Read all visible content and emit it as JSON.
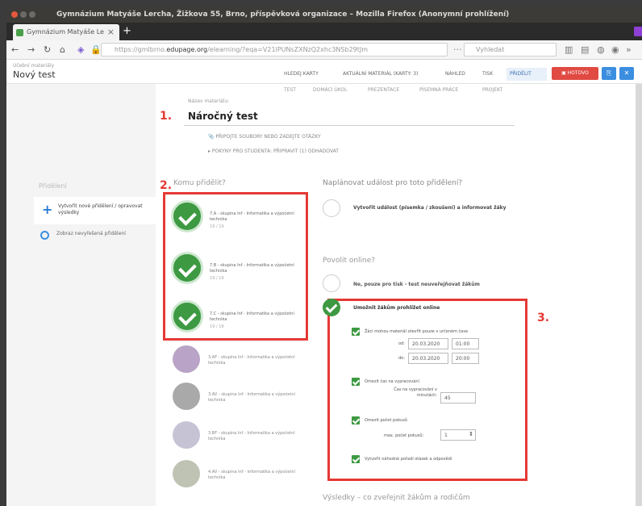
{
  "window": {
    "title": "Gymnázium Matyáše Lercha, Žižkova 55, Brno, příspěvková organizace – Mozilla Firefox (Anonymní prohlížení)"
  },
  "browser": {
    "tab_label": "Gymnázium Matyáše Le",
    "url_prefix": "https://gmlbrno.",
    "url_domain": "edupage.org",
    "url_rest": "/elearning/?eqa=V21lPUNsZXNzQ2xhc3NSb29tJm",
    "search_placeholder": "Vyhledat"
  },
  "app": {
    "breadcrumb": "Učební materiály",
    "doc_title": "Nový test",
    "menu": [
      "HLEDEJ KARTY",
      "AKTUÁLNÍ MATERIÁL (KARTY: 3)",
      "NÁHLED",
      "TISK",
      "PŘIDĚLIT"
    ],
    "done_label": "HOTOVO",
    "sub_tabs": [
      "TEST",
      "DOMÁCÍ ÚKOL",
      "PREZENTACE",
      "PÍSEMNÁ PRÁCE",
      "PROJEKT"
    ]
  },
  "left": {
    "title": "Přidělení",
    "item1": "Vytvořit nové přidělení / opravovat výsledky",
    "item2": "Zobraz nevyřešená přidělení"
  },
  "material": {
    "label": "Název materiálu:",
    "value": "Náročný test",
    "option1": "PŘIPOJTE SOUBORY NEBO ZADEJTE OTÁZKY",
    "option2": "POKYNY PRO STUDENTA: PŘIPRAVIT (1) ODHADOVAT"
  },
  "numbers": {
    "n1": "1.",
    "n2": "2.",
    "n3": "3."
  },
  "assign": {
    "title": "Komu přidělit?",
    "selected": [
      {
        "name": "7.A - skupina Inf - Informatika a výpočetní technika",
        "count": "19 / 19"
      },
      {
        "name": "7.B - skupina Inf - Informatika a výpočetní technika",
        "count": "19 / 19"
      },
      {
        "name": "7.C - skupina Inf - Informatika a výpočetní technika",
        "count": "19 / 19"
      }
    ],
    "unselected": [
      {
        "name": "3.AF - skupina Inf - Informatika a výpočetní technika"
      },
      {
        "name": "3.AV - skupina Inf - Informatika a výpočetní technika"
      },
      {
        "name": "3.BF - skupina Inf - Informatika a výpočetní technika"
      },
      {
        "name": "4.AV - skupina Inf - Informatika a výpočetní technika"
      }
    ]
  },
  "event": {
    "title": "Naplánovat událost pro toto přidělení?",
    "label": "Vytvořit událost (písemka / zkoušení) a informovat žáky"
  },
  "online": {
    "title": "Povolit online?",
    "no_label": "Ne, pouze pro tisk - test neuveřejňovat žákům",
    "yes_label": "Umožnit žákům prohlížet online",
    "chk1": "Žáci mohou materiál otevřít pouze v určeném čase",
    "from_label": "od:",
    "from_date": "20.03.2020",
    "from_time": "01:00",
    "to_label": "do:",
    "to_date": "20.03.2020",
    "to_time": "20:00",
    "chk2": "Omezit čas na vypracování",
    "limit_label": "Čas na vypracování v minutách:",
    "limit_value": "45",
    "chk3": "Omezit počet pokusů",
    "attempts_label": "max. počet pokusů:",
    "attempts_value": "1",
    "chk4": "Vytvořit náhodné pořadí otázek a odpovědí"
  },
  "results": {
    "title": "Výsledky – co zveřejnit žákům a rodičům"
  },
  "colors": {
    "accent": "#3d9942",
    "highlight": "#e53935",
    "primary": "#3b8ee0"
  }
}
